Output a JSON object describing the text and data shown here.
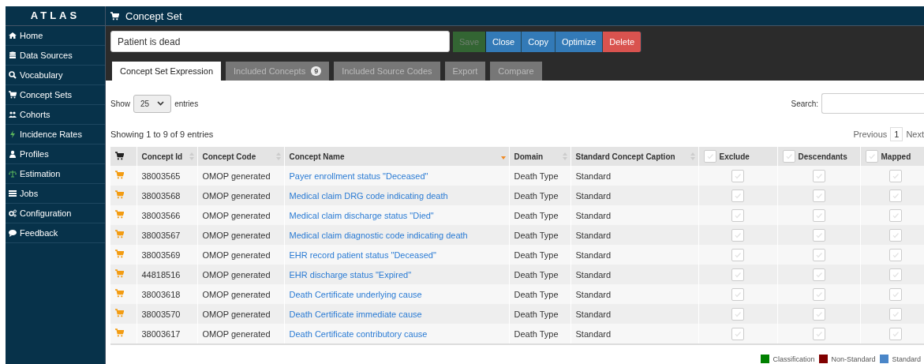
{
  "sidebar": {
    "logo": "ATLAS",
    "items": [
      {
        "label": "Home"
      },
      {
        "label": "Data Sources"
      },
      {
        "label": "Vocabulary"
      },
      {
        "label": "Concept Sets"
      },
      {
        "label": "Cohorts"
      },
      {
        "label": "Incidence Rates"
      },
      {
        "label": "Profiles"
      },
      {
        "label": "Estimation"
      },
      {
        "label": "Jobs"
      },
      {
        "label": "Configuration"
      },
      {
        "label": "Feedback"
      }
    ]
  },
  "header": {
    "title": "Concept Set"
  },
  "name_field": {
    "value": "Patient is dead"
  },
  "buttons": [
    {
      "label": "Save",
      "kind": "success",
      "disabled": true
    },
    {
      "label": "Close",
      "kind": "primary",
      "disabled": false
    },
    {
      "label": "Copy",
      "kind": "primary",
      "disabled": false
    },
    {
      "label": "Optimize",
      "kind": "primary",
      "disabled": false
    },
    {
      "label": "Delete",
      "kind": "danger",
      "disabled": false
    }
  ],
  "tabs": [
    {
      "label": "Concept Set Expression",
      "selected": true
    },
    {
      "label": "Included Concepts",
      "badge": "9",
      "selected": false
    },
    {
      "label": "Included Source Codes",
      "selected": false
    },
    {
      "label": "Export",
      "selected": false
    },
    {
      "label": "Compare",
      "selected": false
    }
  ],
  "length_menu": {
    "label_before": "Show",
    "value": "25",
    "label_after": "entries"
  },
  "search": {
    "label": "Search:"
  },
  "info": "Showing 1 to 9 of 9 entries",
  "pagination": {
    "previous": "Previous",
    "pages": [
      {
        "label": "1",
        "selected": true
      }
    ],
    "next": "Next"
  },
  "table": {
    "columns": [
      {
        "kind": "icon"
      },
      {
        "kind": "text",
        "label": "Concept Id",
        "sorted": false
      },
      {
        "kind": "text",
        "label": "Concept Code",
        "sorted": false
      },
      {
        "kind": "text",
        "label": "Concept Name",
        "sorted": true
      },
      {
        "kind": "text",
        "label": "Domain",
        "sorted": false
      },
      {
        "kind": "text",
        "label": "Standard Concept Caption",
        "sorted": false
      },
      {
        "kind": "checkbox",
        "label": "Exclude",
        "checked": false
      },
      {
        "kind": "checkbox",
        "label": "Descendants",
        "checked": false
      },
      {
        "kind": "checkbox",
        "label": "Mapped",
        "checked": false
      }
    ],
    "rows": [
      {
        "concept_id": "38003565",
        "concept_code": "OMOP generated",
        "concept_name": "Payer enrollment status \"Deceased\"",
        "domain": "Death Type",
        "caption": "Standard",
        "exclude": false,
        "descendants": false,
        "mapped": false
      },
      {
        "concept_id": "38003568",
        "concept_code": "OMOP generated",
        "concept_name": "Medical claim DRG code indicating death",
        "domain": "Death Type",
        "caption": "Standard",
        "exclude": false,
        "descendants": false,
        "mapped": false
      },
      {
        "concept_id": "38003566",
        "concept_code": "OMOP generated",
        "concept_name": "Medical claim discharge status \"Died\"",
        "domain": "Death Type",
        "caption": "Standard",
        "exclude": false,
        "descendants": false,
        "mapped": false
      },
      {
        "concept_id": "38003567",
        "concept_code": "OMOP generated",
        "concept_name": "Medical claim diagnostic code indicating death",
        "domain": "Death Type",
        "caption": "Standard",
        "exclude": false,
        "descendants": false,
        "mapped": false
      },
      {
        "concept_id": "38003569",
        "concept_code": "OMOP generated",
        "concept_name": "EHR record patient status \"Deceased\"",
        "domain": "Death Type",
        "caption": "Standard",
        "exclude": false,
        "descendants": false,
        "mapped": false
      },
      {
        "concept_id": "44818516",
        "concept_code": "OMOP generated",
        "concept_name": "EHR discharge status \"Expired\"",
        "domain": "Death Type",
        "caption": "Standard",
        "exclude": false,
        "descendants": false,
        "mapped": false
      },
      {
        "concept_id": "38003618",
        "concept_code": "OMOP generated",
        "concept_name": "Death Certificate underlying cause",
        "domain": "Death Type",
        "caption": "Standard",
        "exclude": false,
        "descendants": false,
        "mapped": false
      },
      {
        "concept_id": "38003570",
        "concept_code": "OMOP generated",
        "concept_name": "Death Certificate immediate cause",
        "domain": "Death Type",
        "caption": "Standard",
        "exclude": false,
        "descendants": false,
        "mapped": false
      },
      {
        "concept_id": "38003617",
        "concept_code": "OMOP generated",
        "concept_name": "Death Certificate contributory cause",
        "domain": "Death Type",
        "caption": "Standard",
        "exclude": false,
        "descendants": false,
        "mapped": false
      }
    ]
  },
  "legend": [
    {
      "label": "Classification",
      "color": "#008000"
    },
    {
      "label": "Non-Standard",
      "color": "#800000"
    },
    {
      "label": "Standard",
      "color": "#4a86c8"
    }
  ]
}
